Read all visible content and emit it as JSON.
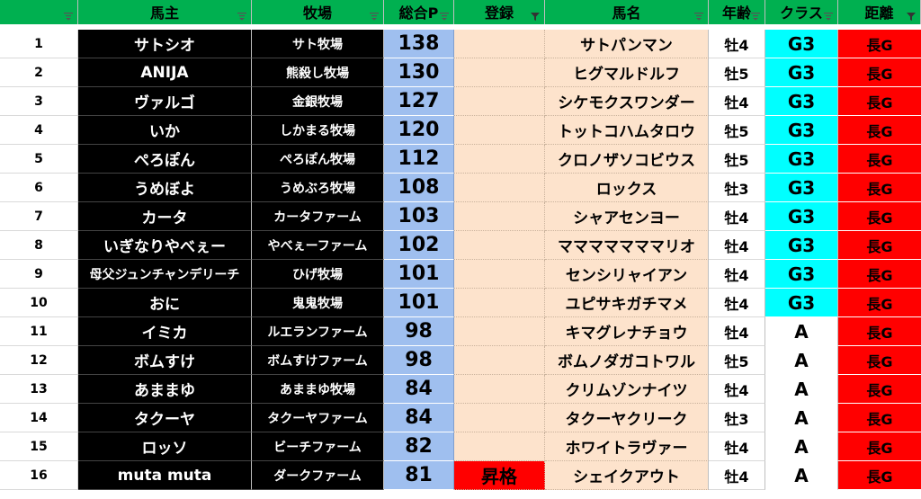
{
  "colors": {
    "header": "#00b050",
    "owner_bg": "#000000",
    "points_bg": "#9fbfef",
    "peach_bg": "#fde3cc",
    "g3_bg": "#00ffff",
    "distance_bg": "#ff0000",
    "promotion_bg": "#ff0000"
  },
  "headers": {
    "num": "",
    "owner": "馬主",
    "farm": "牧場",
    "points": "総合P",
    "register": "登録",
    "horse": "馬名",
    "age": "年齢",
    "class": "クラス",
    "distance": "距離"
  },
  "filter_icons": {
    "num": "filter-dropdown-icon",
    "owner": "filter-dropdown-icon",
    "farm": "filter-dropdown-icon",
    "points": "filter-dropdown-icon",
    "register": "filter-active-icon",
    "horse": "filter-dropdown-icon",
    "age": "filter-dropdown-icon",
    "class": "filter-dropdown-icon",
    "distance": "filter-active-icon"
  },
  "rows": [
    {
      "num": "1",
      "owner": "サトシオ",
      "farm": "サト牧場",
      "points": "138",
      "register": "",
      "horse": "サトパンマン",
      "age": "牡4",
      "class": "G3",
      "distance": "長G"
    },
    {
      "num": "2",
      "owner": "ANIJA",
      "farm": "熊殺し牧場",
      "points": "130",
      "register": "",
      "horse": "ヒグマルドルフ",
      "age": "牡5",
      "class": "G3",
      "distance": "長G"
    },
    {
      "num": "3",
      "owner": "ヴァルゴ",
      "farm": "金銀牧場",
      "points": "127",
      "register": "",
      "horse": "シケモクスワンダー",
      "age": "牡4",
      "class": "G3",
      "distance": "長G"
    },
    {
      "num": "4",
      "owner": "いか",
      "farm": "しかまる牧場",
      "points": "120",
      "register": "",
      "horse": "トットコハムタロウ",
      "age": "牡5",
      "class": "G3",
      "distance": "長G"
    },
    {
      "num": "5",
      "owner": "ぺろぽん",
      "farm": "ぺろぽん牧場",
      "points": "112",
      "register": "",
      "horse": "クロノザソコビウス",
      "age": "牡5",
      "class": "G3",
      "distance": "長G"
    },
    {
      "num": "6",
      "owner": "うめぼよ",
      "farm": "うめぶろ牧場",
      "points": "108",
      "register": "",
      "horse": "ロックス",
      "age": "牡3",
      "class": "G3",
      "distance": "長G"
    },
    {
      "num": "7",
      "owner": "カータ",
      "farm": "カータファーム",
      "points": "103",
      "register": "",
      "horse": "シャアセンヨー",
      "age": "牡4",
      "class": "G3",
      "distance": "長G"
    },
    {
      "num": "8",
      "owner": "いぎなりやべぇー",
      "farm": "やべぇーファーム",
      "points": "102",
      "register": "",
      "horse": "マママママママリオ",
      "age": "牡4",
      "class": "G3",
      "distance": "長G"
    },
    {
      "num": "9",
      "owner": "母父ジュンチャンデリーチ",
      "farm": "ひげ牧場",
      "points": "101",
      "register": "",
      "horse": "センシリャイアン",
      "age": "牡4",
      "class": "G3",
      "distance": "長G"
    },
    {
      "num": "10",
      "owner": "おに",
      "farm": "鬼鬼牧場",
      "points": "101",
      "register": "",
      "horse": "ユピサキガチマメ",
      "age": "牡4",
      "class": "G3",
      "distance": "長G"
    },
    {
      "num": "11",
      "owner": "イミカ",
      "farm": "ルエランファーム",
      "points": "98",
      "register": "",
      "horse": "キマグレナチョウ",
      "age": "牡4",
      "class": "A",
      "distance": "長G"
    },
    {
      "num": "12",
      "owner": "ボムすけ",
      "farm": "ボムすけファーム",
      "points": "98",
      "register": "",
      "horse": "ボムノダガコトワル",
      "age": "牡5",
      "class": "A",
      "distance": "長G"
    },
    {
      "num": "13",
      "owner": "あままゆ",
      "farm": "あままゆ牧場",
      "points": "84",
      "register": "",
      "horse": "クリムゾンナイツ",
      "age": "牡4",
      "class": "A",
      "distance": "長G"
    },
    {
      "num": "14",
      "owner": "タクーヤ",
      "farm": "タクーヤファーム",
      "points": "84",
      "register": "",
      "horse": "タクーヤクリーク",
      "age": "牡3",
      "class": "A",
      "distance": "長G"
    },
    {
      "num": "15",
      "owner": "ロッソ",
      "farm": "ビーチファーム",
      "points": "82",
      "register": "",
      "horse": "ホワイトラヴァー",
      "age": "牡4",
      "class": "A",
      "distance": "長G"
    },
    {
      "num": "16",
      "owner": "muta muta",
      "farm": "ダークファーム",
      "points": "81",
      "register": "昇格",
      "horse": "シェイクアウト",
      "age": "牡4",
      "class": "A",
      "distance": "長G"
    }
  ]
}
